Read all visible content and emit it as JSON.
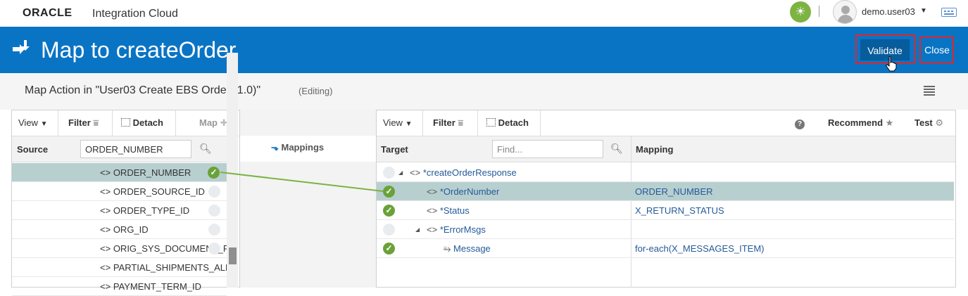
{
  "topbar": {
    "logo": "ORACLE",
    "product": "Integration Cloud",
    "username": "demo.user03",
    "icons": [
      "sun-icon",
      "user-avatar-icon",
      "chevron-down-icon",
      "keyboard-icon"
    ]
  },
  "header": {
    "title": "Map to createOrder",
    "validate_label": "Validate",
    "close_label": "Close",
    "bg_color": "#0a74c4",
    "highlight_color": "#e0262a"
  },
  "subtitle": {
    "text": "Map Action in \"User03 Create EBS Order (1.0)\"",
    "mode": "(Editing)"
  },
  "source_panel": {
    "toolbar": {
      "view": "View",
      "filter": "Filter",
      "detach": "Detach",
      "map": "Map"
    },
    "column_label": "Source",
    "search_value": "ORDER_NUMBER",
    "rows": [
      {
        "label": "ORDER_NUMBER",
        "mapped": true,
        "selected": true
      },
      {
        "label": "ORDER_SOURCE_ID",
        "mapped": false
      },
      {
        "label": "ORDER_TYPE_ID",
        "mapped": false
      },
      {
        "label": "ORG_ID",
        "mapped": false
      },
      {
        "label": "ORIG_SYS_DOCUMENT_REF",
        "mapped": false
      },
      {
        "label": "PARTIAL_SHIPMENTS_ALLOWED",
        "mapped": false
      },
      {
        "label": "PAYMENT_TERM_ID",
        "mapped": false
      }
    ]
  },
  "middle": {
    "label": "Mappings"
  },
  "target_panel": {
    "toolbar": {
      "view": "View",
      "filter": "Filter",
      "detach": "Detach",
      "recommend": "Recommend",
      "test": "Test"
    },
    "column_label": "Target",
    "search_placeholder": "Find...",
    "mapping_column_label": "Mapping",
    "rows": [
      {
        "label": "*createOrderResponse",
        "mapping": "",
        "mapped": false
      },
      {
        "label": "*OrderNumber",
        "mapping": "ORDER_NUMBER",
        "mapped": true,
        "selected": true
      },
      {
        "label": "*Status",
        "mapping": "X_RETURN_STATUS",
        "mapped": true
      },
      {
        "label": "*ErrorMsgs",
        "mapping": "",
        "mapped": false
      },
      {
        "label": "Message",
        "mapping": "for-each(X_MESSAGES_ITEM)",
        "mapped": true
      }
    ]
  },
  "colors": {
    "mapped_green": "#6aa23a",
    "mapping_line": "#7cb342",
    "selected_row": "#b8cfd0"
  }
}
